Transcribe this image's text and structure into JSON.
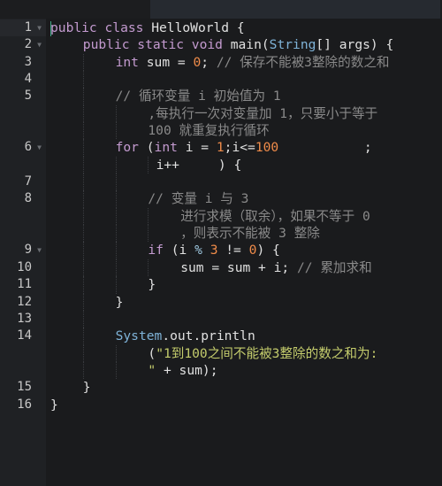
{
  "editor": {
    "language": "java",
    "active_line": "1",
    "rows": [
      {
        "ln": "1",
        "fold": true,
        "indent": 0,
        "tokens": [
          {
            "t": "public class ",
            "c": "kw"
          },
          {
            "t": "HelloWorld {",
            "c": "pl"
          }
        ]
      },
      {
        "ln": "2",
        "fold": true,
        "indent": 4,
        "tokens": [
          {
            "t": "public static void ",
            "c": "kw"
          },
          {
            "t": "main(",
            "c": "pl"
          },
          {
            "t": "String",
            "c": "ty"
          },
          {
            "t": "[] args) {",
            "c": "pl"
          }
        ]
      },
      {
        "ln": "3",
        "fold": false,
        "indent": 8,
        "tokens": [
          {
            "t": "int ",
            "c": "kw"
          },
          {
            "t": "sum = ",
            "c": "pl"
          },
          {
            "t": "0",
            "c": "nm"
          },
          {
            "t": "; ",
            "c": "pl"
          },
          {
            "t": "// 保存不能被3整除的数之和",
            "c": "cm"
          }
        ]
      },
      {
        "ln": "4",
        "fold": false,
        "indent": 8,
        "tokens": []
      },
      {
        "ln": "5",
        "fold": false,
        "indent": 8,
        "tokens": [
          {
            "t": "// 循环变量 i 初始值为 1",
            "c": "cm"
          }
        ]
      },
      {
        "ln": "",
        "fold": false,
        "indent": 12,
        "tokens": [
          {
            "t": ",每执行一次对变量加 1，只要小于等于",
            "c": "cm"
          }
        ]
      },
      {
        "ln": "",
        "fold": false,
        "indent": 12,
        "tokens": [
          {
            "t": "100 就重复执行循环",
            "c": "cm"
          }
        ]
      },
      {
        "ln": "6",
        "fold": true,
        "indent": 8,
        "tokens": [
          {
            "t": "for ",
            "c": "kw"
          },
          {
            "t": "(",
            "c": "pl"
          },
          {
            "t": "int ",
            "c": "kw"
          },
          {
            "t": "i = ",
            "c": "pl"
          },
          {
            "t": "1",
            "c": "nm"
          },
          {
            "t": ";i<=",
            "c": "pl"
          },
          {
            "t": "100",
            "c": "nm"
          },
          {
            "t": "           ;",
            "c": "pl"
          }
        ]
      },
      {
        "ln": "",
        "fold": false,
        "indent": 13,
        "tokens": [
          {
            "t": "i++     ) {",
            "c": "pl"
          }
        ]
      },
      {
        "ln": "7",
        "fold": false,
        "indent": 12,
        "tokens": []
      },
      {
        "ln": "8",
        "fold": false,
        "indent": 12,
        "tokens": [
          {
            "t": "// 变量 i 与 3",
            "c": "cm"
          }
        ]
      },
      {
        "ln": "",
        "fold": false,
        "indent": 16,
        "tokens": [
          {
            "t": "进行求模（取余），如果不等于 0",
            "c": "cm"
          }
        ]
      },
      {
        "ln": "",
        "fold": false,
        "indent": 16,
        "tokens": [
          {
            "t": "，则表示不能被 3 整除",
            "c": "cm"
          }
        ]
      },
      {
        "ln": "9",
        "fold": true,
        "indent": 12,
        "tokens": [
          {
            "t": "if ",
            "c": "kw"
          },
          {
            "t": "(i ",
            "c": "pl"
          },
          {
            "t": "% ",
            "c": "op"
          },
          {
            "t": "3",
            "c": "nm"
          },
          {
            "t": " != ",
            "c": "pl"
          },
          {
            "t": "0",
            "c": "nm"
          },
          {
            "t": ") {",
            "c": "pl"
          }
        ]
      },
      {
        "ln": "10",
        "fold": false,
        "indent": 16,
        "tokens": [
          {
            "t": "sum = sum + i; ",
            "c": "pl"
          },
          {
            "t": "// 累加求和",
            "c": "cm"
          }
        ]
      },
      {
        "ln": "11",
        "fold": false,
        "indent": 12,
        "tokens": [
          {
            "t": "}",
            "c": "pl"
          }
        ]
      },
      {
        "ln": "12",
        "fold": false,
        "indent": 8,
        "tokens": [
          {
            "t": "}",
            "c": "pl"
          }
        ]
      },
      {
        "ln": "13",
        "fold": false,
        "indent": 8,
        "tokens": []
      },
      {
        "ln": "14",
        "fold": false,
        "indent": 8,
        "tokens": [
          {
            "t": "System",
            "c": "ty"
          },
          {
            "t": ".out.println",
            "c": "pl"
          }
        ]
      },
      {
        "ln": "",
        "fold": false,
        "indent": 12,
        "tokens": [
          {
            "t": "(",
            "c": "pl"
          },
          {
            "t": "\"1到100之间不能被3整除的数之和为:",
            "c": "st"
          }
        ]
      },
      {
        "ln": "",
        "fold": false,
        "indent": 12,
        "tokens": [
          {
            "t": "\"",
            "c": "st"
          },
          {
            "t": " + sum);",
            "c": "pl"
          }
        ]
      },
      {
        "ln": "15",
        "fold": false,
        "indent": 4,
        "tokens": [
          {
            "t": "}",
            "c": "pl"
          }
        ]
      },
      {
        "ln": "16",
        "fold": false,
        "indent": 0,
        "tokens": [
          {
            "t": "}",
            "c": "pl"
          }
        ]
      }
    ]
  },
  "icons": {
    "fold": "fold-triangle-icon"
  },
  "colors": {
    "keyword": "#c49bd0",
    "type": "#7fb3d8",
    "number": "#f08c4a",
    "comment": "#8a8a8a",
    "string": "#c4cc6c",
    "background": "#1a1b1d",
    "gutter": "#1f2124"
  }
}
